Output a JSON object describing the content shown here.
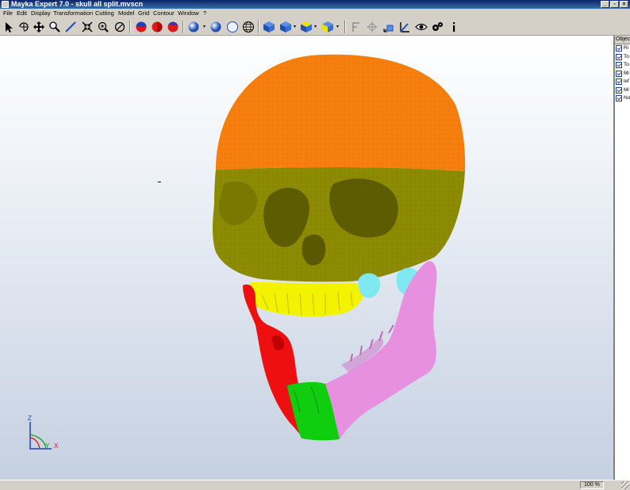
{
  "window": {
    "title": "Mayka Expert 7.0 - skull all split.mvscn",
    "buttons": {
      "minimize": "_",
      "maximize": "▫",
      "close": "×"
    }
  },
  "menu": {
    "items": [
      "File",
      "Edit",
      "Display",
      "Transformation",
      "Cutting",
      "Model",
      "Grid",
      "Contour",
      "Window",
      "?"
    ]
  },
  "toolbar": {
    "tools": [
      {
        "name": "select-arrow-icon"
      },
      {
        "name": "rotate-icon"
      },
      {
        "name": "pan-icon"
      },
      {
        "name": "zoom-magnifier-icon"
      },
      {
        "name": "measure-line-icon"
      },
      {
        "name": "zoom-extents-icon"
      },
      {
        "name": "zoom-window-icon"
      },
      {
        "name": "no-rotate-icon"
      },
      {
        "name": "red-sphere-icon"
      },
      {
        "name": "red-half-sphere-icon"
      },
      {
        "name": "red-blue-sphere-icon"
      },
      {
        "name": "blue-sphere-icon"
      },
      {
        "name": "solid-sphere-icon"
      },
      {
        "name": "outline-sphere-icon"
      },
      {
        "name": "wire-sphere-icon"
      },
      {
        "name": "blue-cube-icon"
      },
      {
        "name": "blue-yellow-cube-icon"
      },
      {
        "name": "yellow-blue-cube-icon"
      },
      {
        "name": "blue-cube-yellow-face-icon"
      },
      {
        "name": "plane-icon"
      },
      {
        "name": "crosshair-icon"
      },
      {
        "name": "move-cube-icon"
      },
      {
        "name": "axis-tool-icon"
      },
      {
        "name": "eye-icon"
      },
      {
        "name": "settings-gears-icon"
      },
      {
        "name": "info-icon"
      }
    ]
  },
  "viewport": {
    "axis": {
      "z": "Z",
      "y": "Y",
      "x": "X"
    },
    "colors": {
      "cranium_top": "#f57e0c",
      "face": "#8c8a00",
      "upper_teeth": "#f3f300",
      "mandible_left": "#ee1010",
      "chin": "#10cd10",
      "mandible_right": "#e890e0",
      "condyles": "#80e8f0"
    }
  },
  "object_panel": {
    "header": "Object",
    "items": [
      "Ri",
      "To",
      "To",
      "Mi",
      "lef",
      "Mi",
      "No"
    ]
  },
  "status": {
    "zoom": "100 %"
  }
}
